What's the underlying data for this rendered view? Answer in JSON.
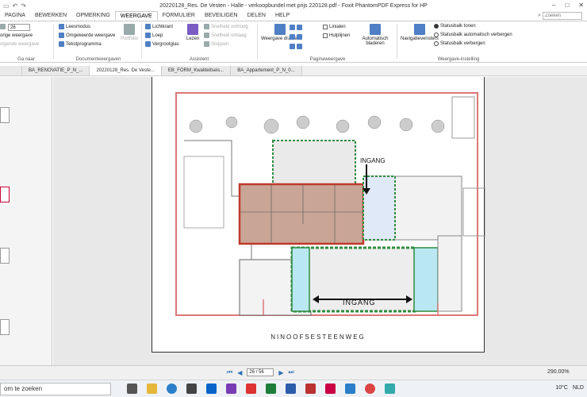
{
  "window": {
    "title": "20220128_Res. De Vesten - Halle - verkoopbundel met prijs 220128.pdf - Foxit PhantomPDF Express for HP"
  },
  "menu_tabs": [
    {
      "label": "PAGINA"
    },
    {
      "label": "BEWERKEN"
    },
    {
      "label": "OPMERKING"
    },
    {
      "label": "WEERGAVE"
    },
    {
      "label": "FORMULIER"
    },
    {
      "label": "BEVEILIGEN"
    },
    {
      "label": "DELEN"
    },
    {
      "label": "HELP"
    }
  ],
  "search": {
    "placeholder": "Zoeken"
  },
  "ribbon": {
    "goto": {
      "prev": "orige weergave",
      "page": "26",
      "next": "olgende weergave",
      "label": "Ga naar"
    },
    "docview": {
      "leesmodus": "Leesmodus",
      "omgekeerd": "Omgekeerde weergave",
      "tekst": "Tekstprogramma",
      "portfolio": "Portfolio",
      "label": "Documentweergaven"
    },
    "assistent": {
      "lichtkrant": "Lichtkrant",
      "loep": "Loep",
      "vergrootglas": "Vergrootglas",
      "lezen": "Lezen",
      "sneller": "Snelheid omhoog",
      "langzamer": "Snelheid omlaag",
      "stoppen": "Stoppen",
      "label": "Assistent"
    },
    "pagina": {
      "draaien": "Weergave draaien",
      "linialen": "Linialen",
      "hulplijnen": "Hulplijnen",
      "auto": "Automatisch bladeren",
      "label": "Paginaweergave"
    },
    "instelling": {
      "nav": "Navigatievensters",
      "tonen": "Statusbalk tonen",
      "autohide": "Statusbalk automatisch verbergen",
      "verbergen": "Statusbalk verbergen",
      "label": "Weergave-instelling"
    }
  },
  "doc_tabs": [
    {
      "label": "BA_RENOVATIE_P_N_..."
    },
    {
      "label": "20220128_Res. De Veste..."
    },
    {
      "label": "EB_FORM_Kwaliteitseis..."
    },
    {
      "label": "BA_Appartement_P_N_0..."
    }
  ],
  "plan": {
    "street": "NINOOFSESTEENWEG",
    "ingang_top": "INGANG",
    "ingang_bottom": "INGANG"
  },
  "status": {
    "page": "26 / 56",
    "zoom": "290.00%"
  },
  "taskbar": {
    "search": "om te zoeken",
    "temp": "10°C",
    "lang": "NLD"
  },
  "colors": {
    "accent": "#2a6fb5",
    "unit_red": "#c0392b",
    "common_green": "#2e8b3e",
    "cyan": "#b9e8f2"
  }
}
